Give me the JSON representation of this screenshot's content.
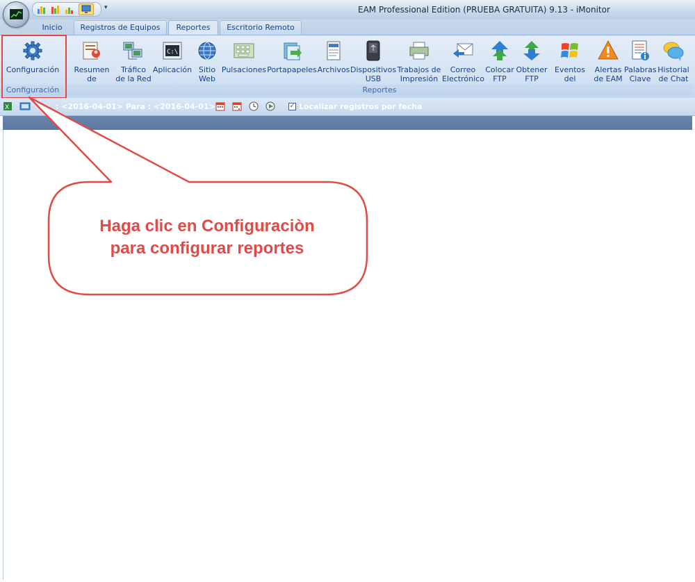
{
  "window": {
    "title": "EAM Professional Edition (PRUEBA GRATUITA) 9.13 - iMonitor"
  },
  "quick_access": {
    "dropdown_glyph": "▾"
  },
  "tabs": [
    {
      "label": "Inicio",
      "active": false
    },
    {
      "label": "Registros de Equipos",
      "active": false
    },
    {
      "label": "Reportes",
      "active": true
    },
    {
      "label": "Escritorio Remoto",
      "active": false
    }
  ],
  "ribbon": {
    "groups": [
      {
        "caption": "Configuración",
        "buttons": [
          {
            "label": "Configuración",
            "icon": "gear-icon"
          }
        ]
      },
      {
        "caption": "Reportes",
        "buttons": [
          {
            "label": "Resumen de\nTrabajos",
            "icon": "work-summary-icon"
          },
          {
            "label": "Tráfico\nde la Red",
            "icon": "network-traffic-icon"
          },
          {
            "label": "Aplicación",
            "icon": "application-icon"
          },
          {
            "label": "Sitio\nWeb",
            "icon": "globe-icon"
          },
          {
            "label": "Pulsaciones",
            "icon": "keyboard-icon"
          },
          {
            "label": "Portapapeles",
            "icon": "clipboard-icon"
          },
          {
            "label": "Archivos",
            "icon": "document-icon"
          },
          {
            "label": "Dispositivos\nUSB",
            "icon": "usb-drive-icon"
          },
          {
            "label": "Trabajos de\nImpresión",
            "icon": "printer-icon"
          },
          {
            "label": "Correo\nElectrónico",
            "icon": "email-icon"
          },
          {
            "label": "Colocar\nFTP",
            "icon": "ftp-upload-icon"
          },
          {
            "label": "Obtener\nFTP",
            "icon": "ftp-download-icon"
          },
          {
            "label": "Eventos del\nSistema",
            "icon": "windows-logo-icon"
          },
          {
            "label": "Alertas\nde EAM",
            "icon": "warning-icon"
          },
          {
            "label": "Palabras\nClave",
            "icon": "keywords-icon"
          },
          {
            "label": "Historial\nde Chat",
            "icon": "chat-icon"
          }
        ]
      }
    ]
  },
  "filter": {
    "date_range": ": <2016-04-01> Para : <2016-04-01>",
    "locate_checked": true,
    "locate_label": "Localizar registros por fecha"
  },
  "callout": {
    "text": "Haga clic en Configuraciòn\npara configurar reportes",
    "color": "#e04a47"
  }
}
